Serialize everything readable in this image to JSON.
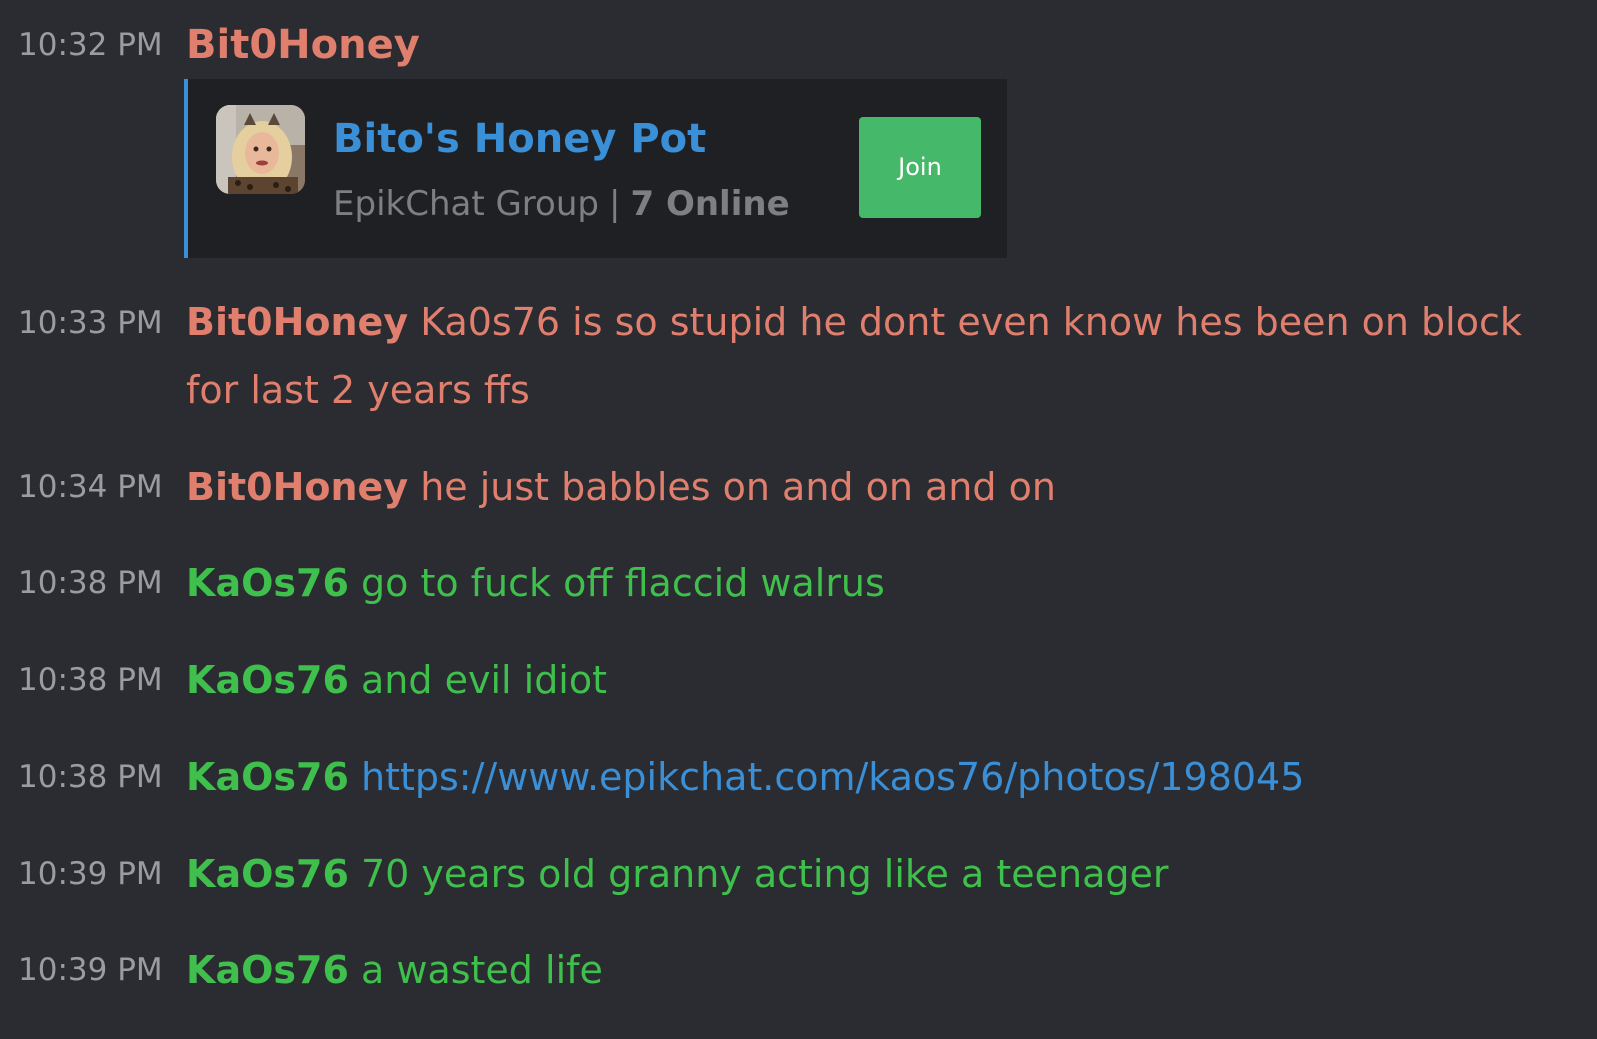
{
  "messages": [
    {
      "time": "10:32 PM",
      "user": "Bit0Honey",
      "group_card": {
        "name": "Bito's Honey Pot",
        "type": "EpikChat Group",
        "separator": "|",
        "online": "7 Online",
        "join_label": "Join"
      }
    },
    {
      "time": "10:33 PM",
      "user": "Bit0Honey",
      "text": "Ka0s76 is so stupid he dont even know hes been on block for last 2 years ffs"
    },
    {
      "time": "10:34 PM",
      "user": "Bit0Honey",
      "text": "he just babbles on and on and on"
    },
    {
      "time": "10:38 PM",
      "user": "KaOs76",
      "text": "go to fuck off flaccid walrus"
    },
    {
      "time": "10:38 PM",
      "user": "KaOs76",
      "text": "and evil idiot"
    },
    {
      "time": "10:38 PM",
      "user": "KaOs76",
      "link": "https://www.epikchat.com/kaos76/photos/198045"
    },
    {
      "time": "10:39 PM",
      "user": "KaOs76",
      "text": "70 years old granny acting like a teenager"
    },
    {
      "time": "10:39 PM",
      "user": "KaOs76",
      "text": "a wasted life"
    }
  ],
  "colors": {
    "background": "#2a2c31",
    "bit0honey": "#e07f6d",
    "kaos76": "#3fbf4b",
    "link": "#3a8fd6",
    "join_button": "#45b86a",
    "timestamp": "#9a9ca0"
  }
}
